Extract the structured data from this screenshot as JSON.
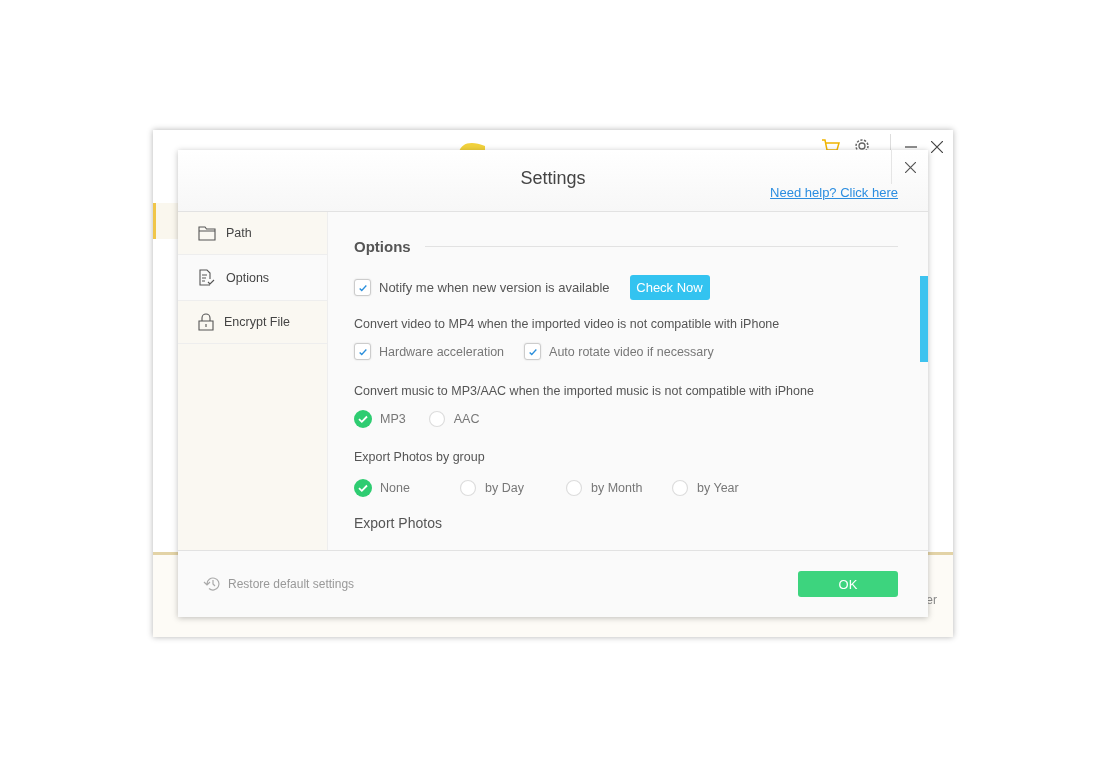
{
  "app_window": {
    "partial_label": "er"
  },
  "dialog": {
    "title": "Settings",
    "help_link": "Need help? Click here",
    "sidebar": {
      "items": [
        {
          "label": "Path",
          "selected": false
        },
        {
          "label": "Options",
          "selected": true
        },
        {
          "label": "Encrypt File",
          "selected": false
        }
      ]
    },
    "options": {
      "heading": "Options",
      "notify": {
        "label": "Notify me when new version is available",
        "checked": true
      },
      "check_button": "Check Now",
      "video_label": "Convert video to MP4 when the imported video is not compatible with iPhone",
      "video_options": [
        {
          "label": "Hardware acceleration",
          "checked": true
        },
        {
          "label": "Auto rotate video if necessary",
          "checked": true
        }
      ],
      "music_label": "Convert music to MP3/AAC when the imported music is not compatible with iPhone",
      "music_formats": [
        {
          "label": "MP3",
          "selected": true
        },
        {
          "label": "AAC",
          "selected": false
        }
      ],
      "group_label": "Export Photos by group",
      "group_options": [
        {
          "label": "None",
          "selected": true
        },
        {
          "label": "by Day",
          "selected": false
        },
        {
          "label": "by Month",
          "selected": false
        },
        {
          "label": "by Year",
          "selected": false
        }
      ],
      "export_heading": "Export Photos"
    },
    "footer": {
      "restore": "Restore default settings",
      "ok": "OK"
    }
  }
}
